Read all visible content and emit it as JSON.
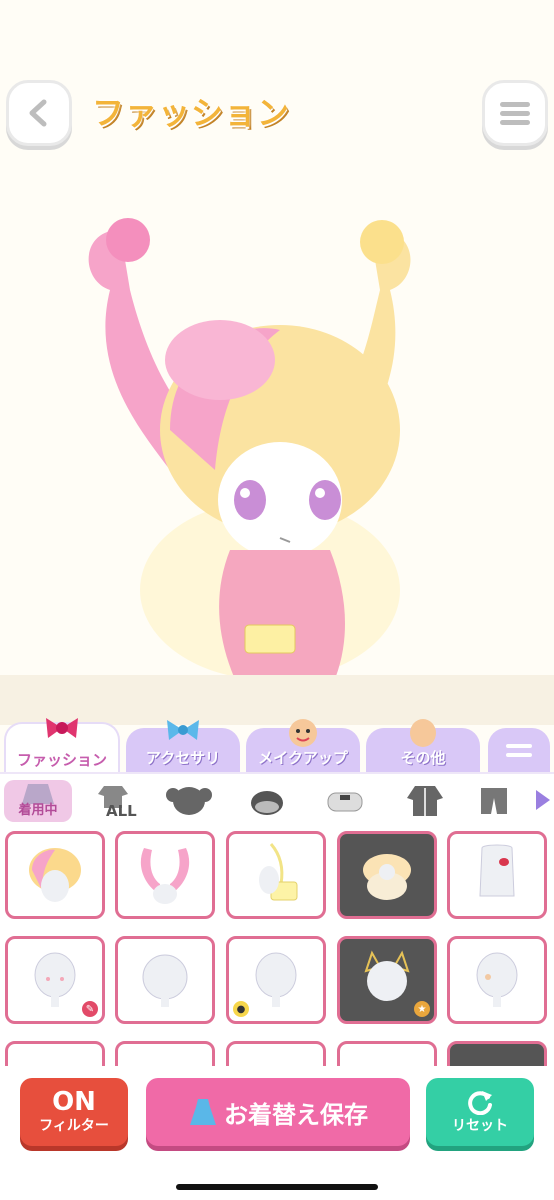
{
  "header": {
    "title": "ファッション"
  },
  "tabs": [
    {
      "label": "ファッション",
      "active": true
    },
    {
      "label": "アクセサリ",
      "active": false
    },
    {
      "label": "メイクアップ",
      "active": false
    },
    {
      "label": "その他",
      "active": false
    }
  ],
  "categories": {
    "wearing_label": "着用中",
    "all_label": "ALL"
  },
  "bottom": {
    "filter_on": "ON",
    "filter_label": "フィルター",
    "save_label": "お着替え保存",
    "reset_label": "リセット"
  },
  "colors": {
    "accent_pink": "#e06e93",
    "tab_purple": "#d9c8f7",
    "filter_red": "#e74f3d",
    "save_pink": "#f06aa7",
    "reset_green": "#34cfa5"
  }
}
